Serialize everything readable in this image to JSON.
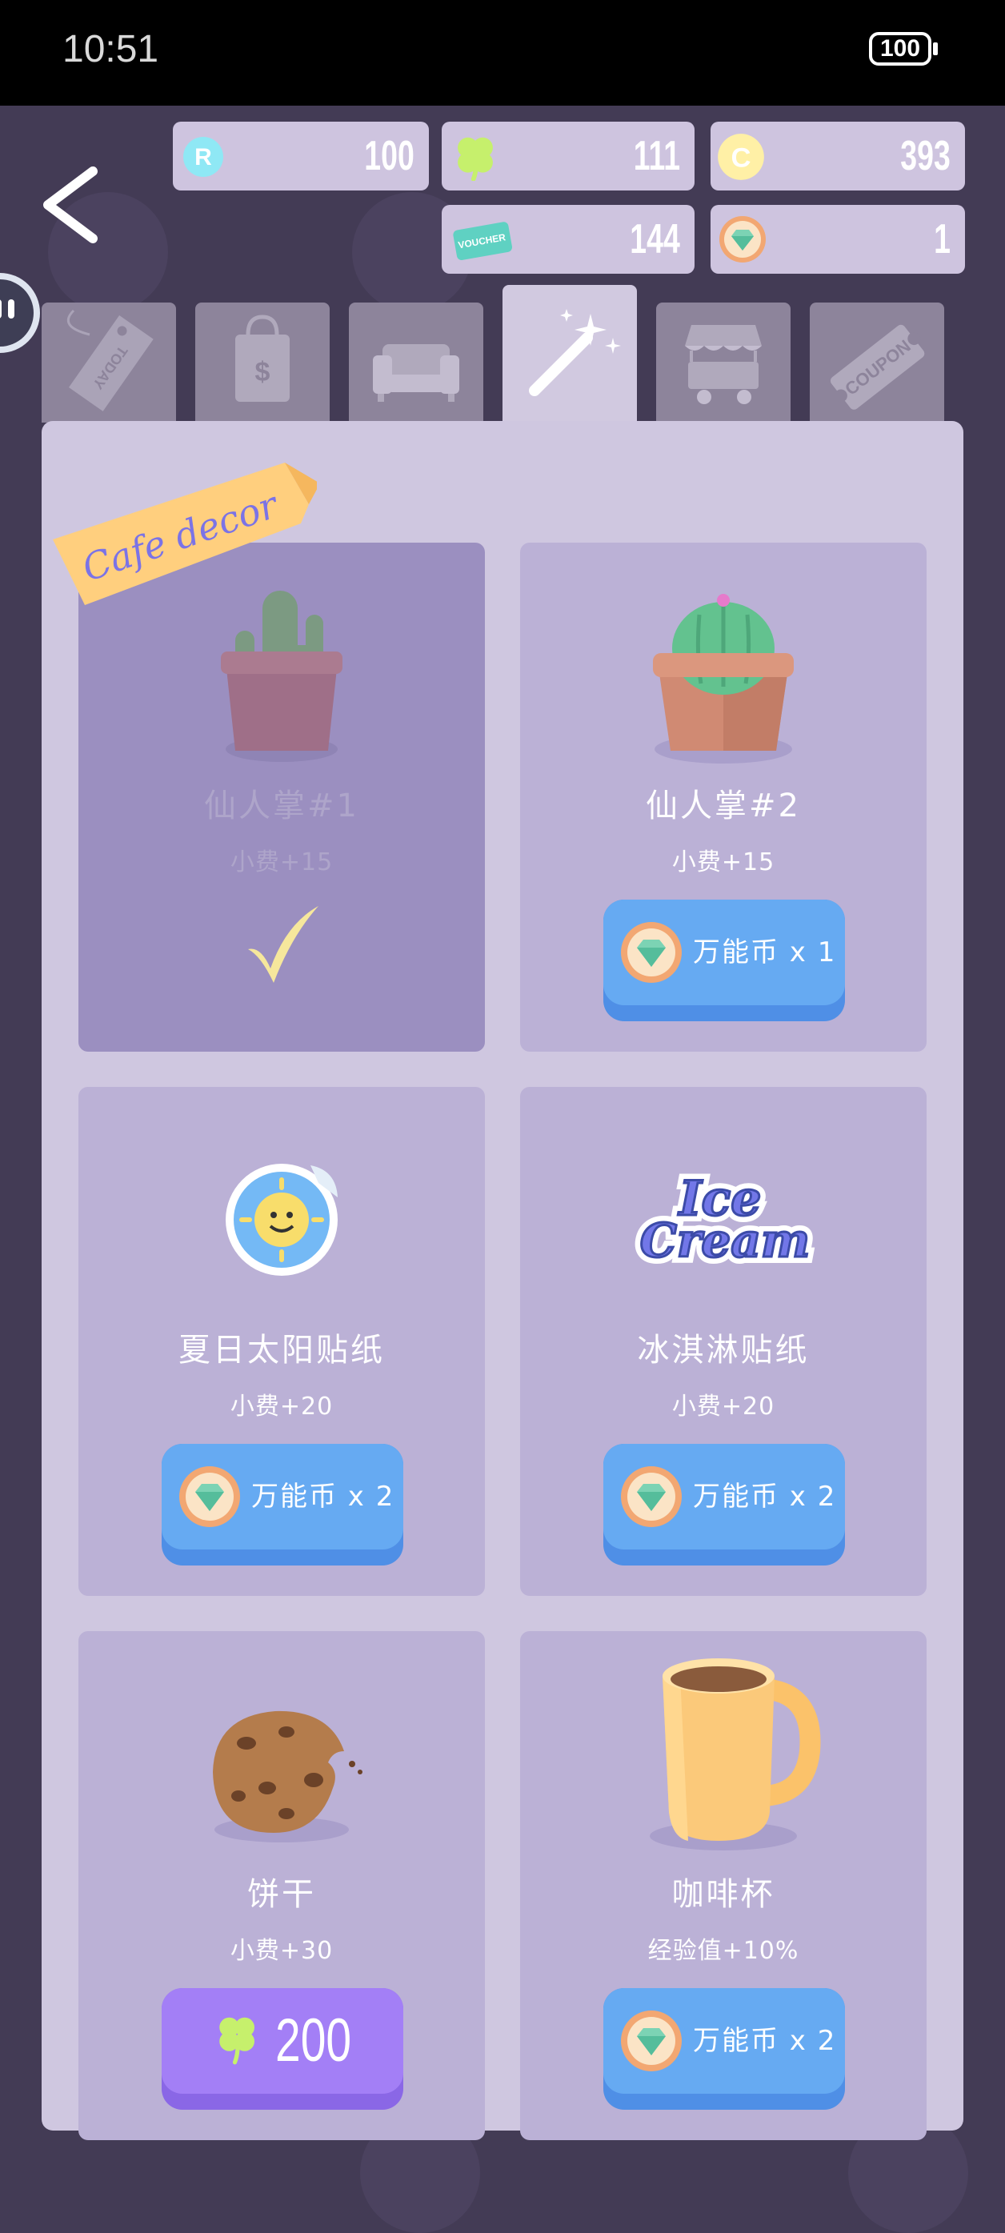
{
  "status_bar": {
    "time": "10:51",
    "battery": "100"
  },
  "currencies": {
    "r_coins": "100",
    "clovers": "111",
    "c_coins": "393",
    "vouchers": "144",
    "gems": "1"
  },
  "tabs": [
    {
      "id": "today",
      "label": "TODAY"
    },
    {
      "id": "shop"
    },
    {
      "id": "furniture"
    },
    {
      "id": "decor",
      "active": true
    },
    {
      "id": "stall"
    },
    {
      "id": "coupon",
      "label": "COUPON"
    }
  ],
  "voucher_icon_text": "VOUCHER",
  "currency_letters": {
    "r": "R",
    "c": "C"
  },
  "tab_icon_text": {
    "today": "TODAY",
    "shop": "$",
    "coupon": "COUPON"
  },
  "section_ribbon": "Cafe decor",
  "items": [
    {
      "name": "仙人掌#1",
      "bonus": "小费+15",
      "owned": true
    },
    {
      "name": "仙人掌#2",
      "bonus": "小费+15",
      "price_label": "万能币 x 1"
    },
    {
      "name": "夏日太阳贴纸",
      "bonus": "小费+20",
      "price_label": "万能币 x 2"
    },
    {
      "name": "冰淇淋贴纸",
      "bonus": "小费+20",
      "price_label": "万能币 x 2",
      "sticker_text": [
        "Ice",
        "Cream"
      ]
    },
    {
      "name": "饼干",
      "bonus": "小费+30",
      "price_label": "200"
    },
    {
      "name": "咖啡杯",
      "bonus": "经验值+10%",
      "price_label": "万能币 x 2"
    }
  ],
  "colors": {
    "background": "#433b55",
    "panel": "#cfc7e0",
    "card": "#bbb1d6",
    "owned_card": "#9b8fc0",
    "buy_button": "#66aaf2",
    "clover_button": "#a37ff6",
    "ribbon": "#ffcf7e"
  }
}
